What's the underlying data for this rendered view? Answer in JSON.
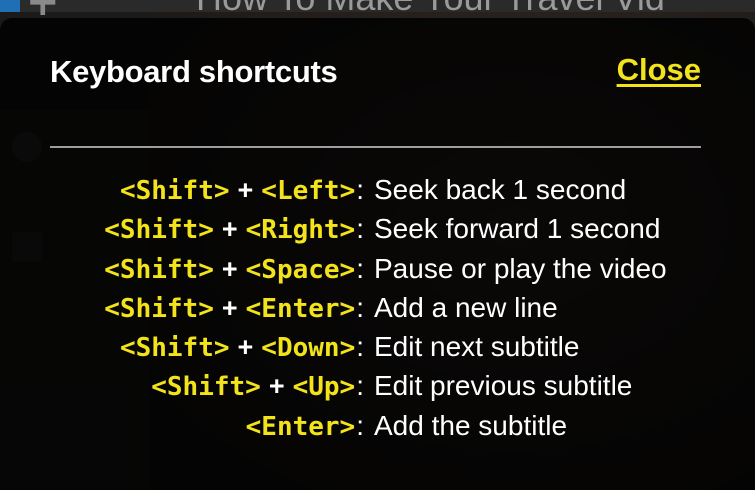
{
  "background": {
    "title_fragment": "How To Make Your Travel Vid"
  },
  "modal": {
    "title": "Keyboard shortcuts",
    "close_label": "Close",
    "accent_color": "#f2e31a"
  },
  "shortcuts": [
    {
      "mod": "<Shift>",
      "plus": "+",
      "key": "<Left>",
      "colon": ":",
      "description": "Seek back 1 second"
    },
    {
      "mod": "<Shift>",
      "plus": "+",
      "key": "<Right>",
      "colon": ":",
      "description": "Seek forward 1 second"
    },
    {
      "mod": "<Shift>",
      "plus": "+",
      "key": "<Space>",
      "colon": ":",
      "description": "Pause or play the video"
    },
    {
      "mod": "<Shift>",
      "plus": "+",
      "key": "<Enter>",
      "colon": ":",
      "description": "Add a new line"
    },
    {
      "mod": "<Shift>",
      "plus": "+",
      "key": "<Down>",
      "colon": ":",
      "description": "Edit next subtitle"
    },
    {
      "mod": "<Shift>",
      "plus": "+",
      "key": "<Up>",
      "colon": ":",
      "description": "Edit previous subtitle"
    },
    {
      "mod": "",
      "plus": "",
      "key": "<Enter>",
      "colon": ":",
      "description": "Add the subtitle"
    }
  ]
}
